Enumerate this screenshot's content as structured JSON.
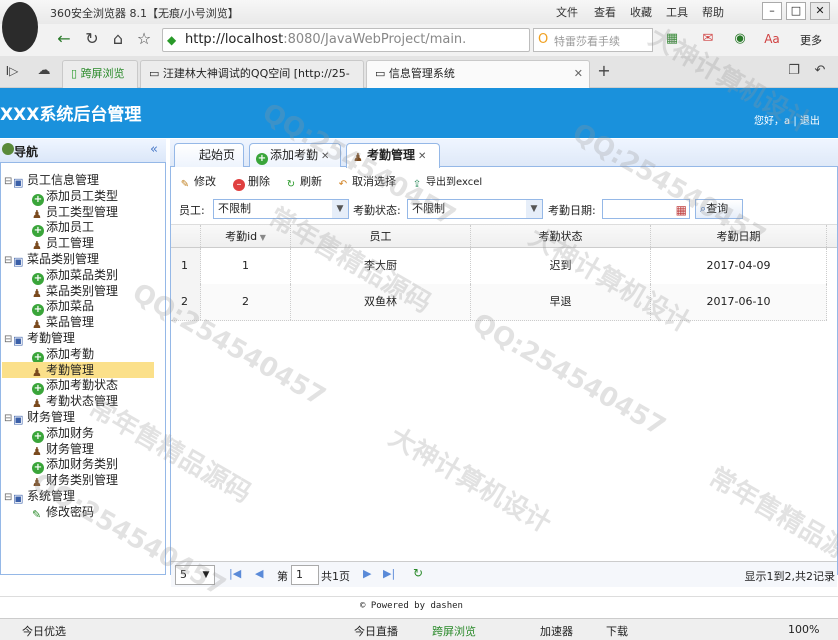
{
  "browser": {
    "title": "360安全浏览器 8.1【无痕/小号浏览】",
    "menu": [
      "文件",
      "查看",
      "收藏",
      "工具",
      "帮助"
    ],
    "url_host": "http://localhost",
    "url_rest": ":8080/JavaWebProject/main.",
    "search_placeholder": "特雷莎看手续",
    "more_label": "更多",
    "tabs": [
      "跨屏浏览",
      "汪建林大神调试的QQ空间 [http://25-",
      "信息管理系统"
    ]
  },
  "app": {
    "title": "XXX系统后台管理",
    "user_greeting": "您好，a",
    "logout": "退出"
  },
  "sidebar": {
    "title": "导航",
    "items": [
      {
        "label": "员工信息管理",
        "type": "folder",
        "level": 0
      },
      {
        "label": "添加员工类型",
        "type": "add",
        "level": 1
      },
      {
        "label": "员工类型管理",
        "type": "user",
        "level": 1
      },
      {
        "label": "添加员工",
        "type": "add",
        "level": 1
      },
      {
        "label": "员工管理",
        "type": "user",
        "level": 1
      },
      {
        "label": "菜品类别管理",
        "type": "folder",
        "level": 0
      },
      {
        "label": "添加菜品类别",
        "type": "add",
        "level": 1
      },
      {
        "label": "菜品类别管理",
        "type": "user",
        "level": 1
      },
      {
        "label": "添加菜品",
        "type": "add",
        "level": 1
      },
      {
        "label": "菜品管理",
        "type": "user",
        "level": 1
      },
      {
        "label": "考勤管理",
        "type": "folder",
        "level": 0
      },
      {
        "label": "添加考勤",
        "type": "add",
        "level": 1
      },
      {
        "label": "考勤管理",
        "type": "user",
        "level": 1,
        "selected": true
      },
      {
        "label": "添加考勤状态",
        "type": "add",
        "level": 1
      },
      {
        "label": "考勤状态管理",
        "type": "user",
        "level": 1
      },
      {
        "label": "财务管理",
        "type": "folder",
        "level": 0
      },
      {
        "label": "添加财务",
        "type": "add",
        "level": 1
      },
      {
        "label": "财务管理",
        "type": "user",
        "level": 1
      },
      {
        "label": "添加财务类别",
        "type": "add",
        "level": 1
      },
      {
        "label": "财务类别管理",
        "type": "user",
        "level": 1
      },
      {
        "label": "系统管理",
        "type": "folder",
        "level": 0
      },
      {
        "label": "修改密码",
        "type": "pen",
        "level": 1
      }
    ]
  },
  "content_tabs": [
    "起始页",
    "添加考勤",
    "考勤管理"
  ],
  "toolbar": {
    "edit": "修改",
    "delete": "删除",
    "refresh": "刷新",
    "cancel_select": "取消选择",
    "export": "导出到excel"
  },
  "filters": {
    "employee_label": "员工:",
    "employee_value": "不限制",
    "status_label": "考勤状态:",
    "status_value": "不限制",
    "date_label": "考勤日期:",
    "query_label": "查询"
  },
  "grid": {
    "columns": [
      "考勤id",
      "员工",
      "考勤状态",
      "考勤日期"
    ],
    "rows": [
      {
        "num": "1",
        "id": "1",
        "employee": "李大厨",
        "status": "迟到",
        "date": "2017-04-09"
      },
      {
        "num": "2",
        "id": "2",
        "employee": "双鱼林",
        "status": "早退",
        "date": "2017-06-10"
      }
    ]
  },
  "pager": {
    "page_size": "5",
    "page_prefix": "第",
    "page_value": "1",
    "page_suffix": "共1页",
    "summary": "显示1到2,共2记录"
  },
  "footer": "© Powered by dashen",
  "statusbar": [
    "今日优选",
    "今日直播",
    "跨屏浏览",
    "加速器",
    "下载",
    "100%"
  ],
  "watermarks": [
    "QQ:254540457",
    "常年售精品源码",
    "大神计算机设计"
  ]
}
